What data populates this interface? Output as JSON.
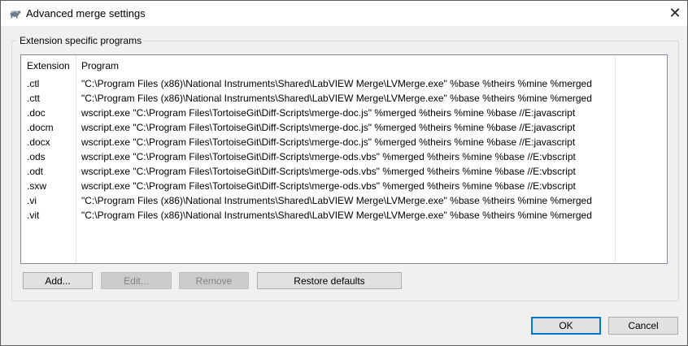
{
  "window": {
    "title": "Advanced merge settings",
    "close_symbol": "✕"
  },
  "group": {
    "legend": "Extension specific programs"
  },
  "table": {
    "columns": [
      "Extension",
      "Program"
    ],
    "rows": [
      {
        "ext": ".ctl",
        "program": "\"C:\\Program Files (x86)\\National Instruments\\Shared\\LabVIEW Merge\\LVMerge.exe\" %base %theirs %mine %merged"
      },
      {
        "ext": ".ctt",
        "program": "\"C:\\Program Files (x86)\\National Instruments\\Shared\\LabVIEW Merge\\LVMerge.exe\" %base %theirs %mine %merged"
      },
      {
        "ext": ".doc",
        "program": "wscript.exe \"C:\\Program Files\\TortoiseGit\\Diff-Scripts\\merge-doc.js\" %merged %theirs %mine %base //E:javascript"
      },
      {
        "ext": ".docm",
        "program": "wscript.exe \"C:\\Program Files\\TortoiseGit\\Diff-Scripts\\merge-doc.js\" %merged %theirs %mine %base //E:javascript"
      },
      {
        "ext": ".docx",
        "program": "wscript.exe \"C:\\Program Files\\TortoiseGit\\Diff-Scripts\\merge-doc.js\" %merged %theirs %mine %base //E:javascript"
      },
      {
        "ext": ".ods",
        "program": "wscript.exe \"C:\\Program Files\\TortoiseGit\\Diff-Scripts\\merge-ods.vbs\" %merged %theirs %mine %base //E:vbscript"
      },
      {
        "ext": ".odt",
        "program": "wscript.exe \"C:\\Program Files\\TortoiseGit\\Diff-Scripts\\merge-ods.vbs\" %merged %theirs %mine %base //E:vbscript"
      },
      {
        "ext": ".sxw",
        "program": "wscript.exe \"C:\\Program Files\\TortoiseGit\\Diff-Scripts\\merge-ods.vbs\" %merged %theirs %mine %base //E:vbscript"
      },
      {
        "ext": ".vi",
        "program": "\"C:\\Program Files (x86)\\National Instruments\\Shared\\LabVIEW Merge\\LVMerge.exe\" %base %theirs %mine %merged"
      },
      {
        "ext": ".vit",
        "program": "\"C:\\Program Files (x86)\\National Instruments\\Shared\\LabVIEW Merge\\LVMerge.exe\" %base %theirs %mine %merged"
      }
    ]
  },
  "buttons": {
    "add": "Add...",
    "edit": "Edit...",
    "remove": "Remove",
    "restore": "Restore defaults",
    "ok": "OK",
    "cancel": "Cancel"
  },
  "colors": {
    "accent": "#0078d7",
    "list_border": "#828790"
  }
}
